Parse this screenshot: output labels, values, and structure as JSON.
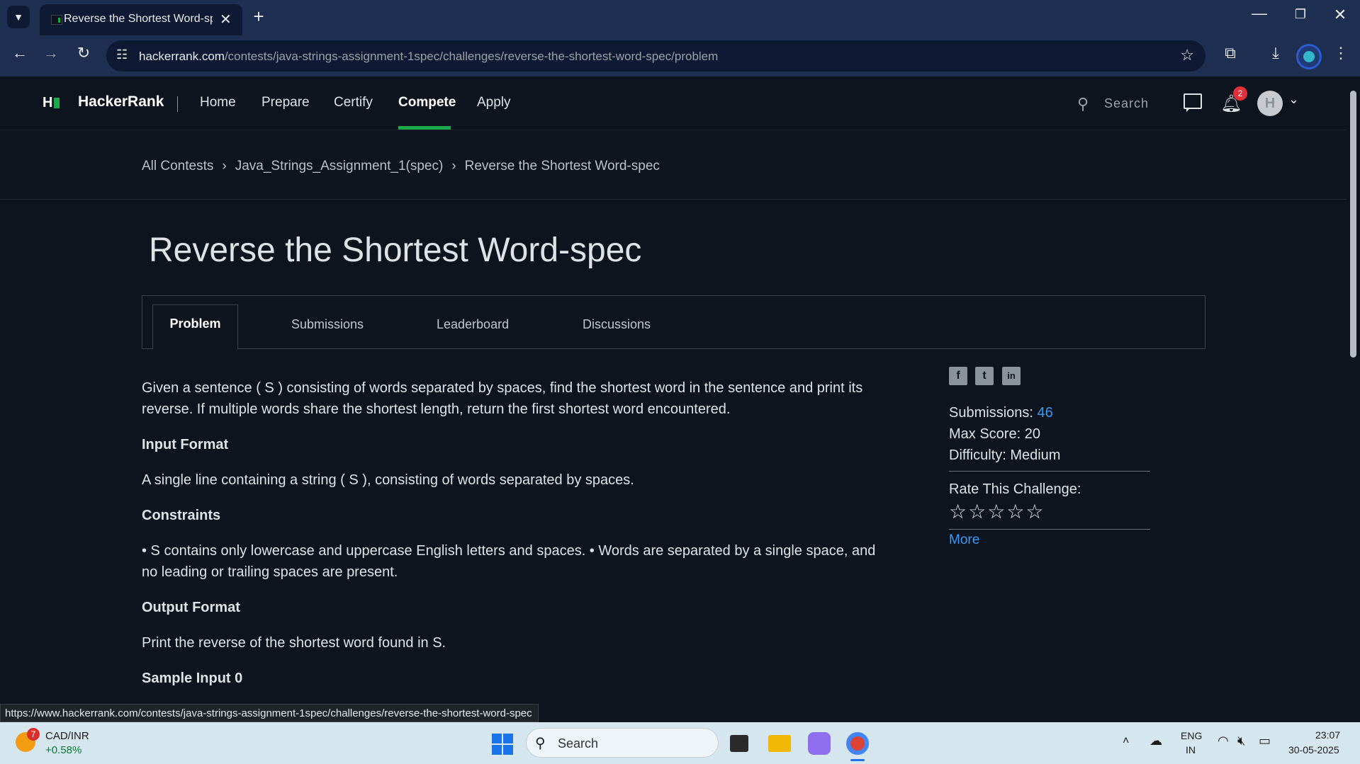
{
  "browser": {
    "tab_title": "Reverse the Shortest Word-spec",
    "url_domain": "hackerrank.com",
    "url_path": "/contests/java-strings-assignment-1spec/challenges/reverse-the-shortest-word-spec/problem",
    "status_url": "https://www.hackerrank.com/contests/java-strings-assignment-1spec/challenges/reverse-the-shortest-word-spec"
  },
  "nav": {
    "logo": "H",
    "brand": "HackerRank",
    "links": [
      "Home",
      "Prepare",
      "Certify",
      "Compete",
      "Apply"
    ],
    "active": "Compete",
    "search_placeholder": "Search",
    "notification_count": "2",
    "avatar_letter": "H"
  },
  "breadcrumb": [
    "All Contests",
    "Java_Strings_Assignment_1(spec)",
    "Reverse the Shortest Word-spec"
  ],
  "challenge": {
    "title": "Reverse the Shortest Word-spec",
    "tabs": [
      "Problem",
      "Submissions",
      "Leaderboard",
      "Discussions"
    ],
    "description": "Given a sentence ( S ) consisting of words separated by spaces, find the shortest word in the sentence and print its reverse. If multiple words share the shortest length, return the first shortest word encountered.",
    "input_format_heading": "Input Format",
    "input_format": "A single line containing a string ( S ), consisting of words separated by spaces.",
    "constraints_heading": "Constraints",
    "constraints": "• S contains only lowercase and uppercase English letters and spaces. • Words are separated by a single space, and no leading or trailing spaces are present.",
    "output_format_heading": "Output Format",
    "output_format": "Print the reverse of the shortest word found in S.",
    "sample_input_heading": "Sample Input 0"
  },
  "sidebar": {
    "submissions_label": "Submissions:",
    "submissions_value": "46",
    "max_score_label": "Max Score:",
    "max_score_value": "20",
    "difficulty_label": "Difficulty:",
    "difficulty_value": "Medium",
    "rate_label": "Rate This Challenge:",
    "more": "More"
  },
  "taskbar": {
    "ticker_name": "CAD/INR",
    "ticker_change": "+0.58%",
    "ticker_badge": "7",
    "search": "Search",
    "lang_top": "ENG",
    "lang_bottom": "IN",
    "time": "23:07",
    "date": "30-05-2025"
  }
}
